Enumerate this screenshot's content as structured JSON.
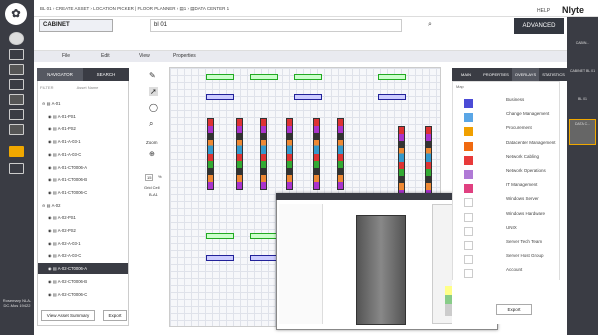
{
  "brand": "Nlyte",
  "topbar": {
    "breadcrumb": "BL 01 › CREATE ASSET › LOCATION PICKER | FLOOR PLANNER › ▤1 › ▤DATA CENTER 1",
    "help": "HELP"
  },
  "bar2": {
    "cabinet_value": "CABINET",
    "location_value": "bl 01",
    "advanced": "ADVANCED"
  },
  "menu": {
    "file": "File",
    "edit": "Edit",
    "view": "View",
    "properties": "Properties"
  },
  "nav": {
    "tab_navigator": "NAVIGATOR",
    "tab_search": "SEARCH",
    "filter_label": "FILTER",
    "filter_placeholder": "Asset Name",
    "rows": [
      "A-01",
      "A-01-PS1",
      "A-01-PS2",
      "A-01-A-03-1",
      "A-01-A-03-C",
      "A-01-CT0006-A",
      "A-01-CT0006-B",
      "A-01-CT0006-C",
      "A-02",
      "A-02-PS1",
      "A-02-PS2",
      "A-02-A-03-1",
      "A-02-A-03-C",
      "A-02-CT0006-A",
      "A-02-CT0006-B",
      "A-02-CT0006-C"
    ],
    "view_summary": "View Asset Summary",
    "export": "Export"
  },
  "left_footer": "Rosemary\nNLA-DC-Mos\n19422",
  "tools": {
    "zoom": "Zoom",
    "zoom_value": "15",
    "zoom_unit": "%",
    "grid_cell": "Grid Cell",
    "grid_value": "B-A1"
  },
  "right_tabs": [
    "MAIN",
    "PROPERTIES",
    "OVERLAYS",
    "STATISTICS"
  ],
  "layers_title": "Map",
  "layers": [
    {
      "label": "Business",
      "color": "#4b4bd6"
    },
    {
      "label": "Change Management",
      "color": "#5aa6e6"
    },
    {
      "label": "Procurement",
      "color": "#f0a000"
    },
    {
      "label": "Datacenter Management",
      "color": "#f06a10"
    },
    {
      "label": "Network Cabling",
      "color": "#e83a3a"
    },
    {
      "label": "Network Operations",
      "color": "#b07ad6"
    },
    {
      "label": "IT Management",
      "color": "#e04080"
    },
    {
      "label": "Windows Server",
      "color": "#ffffff"
    },
    {
      "label": "Windows Hardware",
      "color": "#ffffff"
    },
    {
      "label": "UNIX",
      "color": "#ffffff"
    },
    {
      "label": "Server Tech Team",
      "color": "#ffffff"
    },
    {
      "label": "Server Host Group",
      "color": "#ffffff"
    },
    {
      "label": "Account",
      "color": "#ffffff"
    }
  ],
  "right_export": "Export",
  "right_sidebar": [
    "CABIN...",
    "CABINET BL 01",
    "BL 01",
    "DATA C..."
  ]
}
